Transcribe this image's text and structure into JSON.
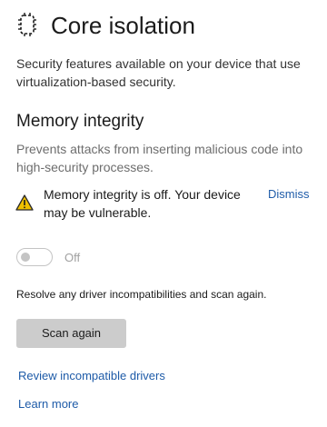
{
  "header": {
    "icon": "core-isolation-chip-icon",
    "title": "Core isolation",
    "description": "Security features available on your device that use virtualization-based security."
  },
  "memory_integrity": {
    "title": "Memory integrity",
    "description": "Prevents attacks from inserting malicious code into high-security processes.",
    "warning": {
      "icon": "warning-triangle-icon",
      "color": "#f0c000",
      "text": "Memory integrity is off. Your device may be vulnerable.",
      "dismiss_label": "Dismiss"
    },
    "toggle": {
      "state_label": "Off",
      "enabled": false
    }
  },
  "resolve_text": "Resolve any driver incompatibilities and scan again.",
  "scan_button_label": "Scan again",
  "links": {
    "review_drivers": "Review incompatible drivers",
    "learn_more": "Learn more"
  },
  "colors": {
    "link": "#1e5ba8",
    "button_bg": "#cccccc",
    "muted_text": "#6d6d6d"
  }
}
